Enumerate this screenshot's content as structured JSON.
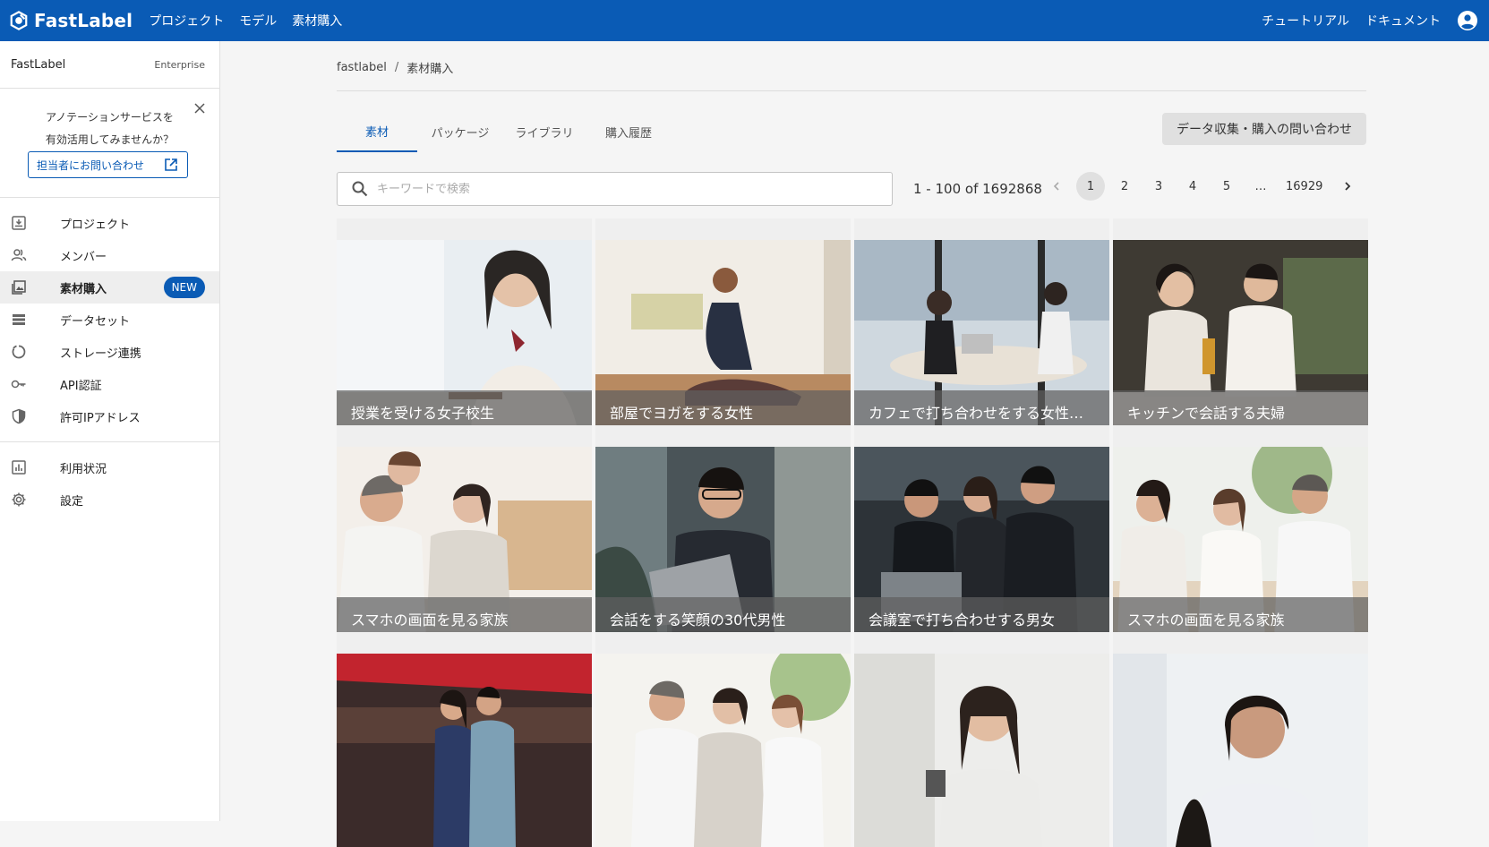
{
  "app": {
    "brand": "FastLabel"
  },
  "topnav": {
    "items": [
      "プロジェクト",
      "モデル",
      "素材購入"
    ],
    "right": [
      "チュートリアル",
      "ドキュメント"
    ]
  },
  "sidebar": {
    "org_name": "FastLabel",
    "org_plan": "Enterprise",
    "promo": {
      "line1": "アノテーションサービスを",
      "line2": "有効活用してみませんか？",
      "link_label": "担当者にお問い合わせ"
    },
    "items": [
      {
        "label": "プロジェクト",
        "icon": "project-icon"
      },
      {
        "label": "メンバー",
        "icon": "members-icon"
      },
      {
        "label": "素材購入",
        "icon": "image-icon",
        "badge": "NEW",
        "active": true
      },
      {
        "label": "データセット",
        "icon": "dataset-icon"
      },
      {
        "label": "ストレージ連携",
        "icon": "storage-icon"
      },
      {
        "label": "API認証",
        "icon": "key-icon"
      },
      {
        "label": "許可IPアドレス",
        "icon": "shield-icon"
      }
    ],
    "items2": [
      {
        "label": "利用状況",
        "icon": "chart-icon"
      },
      {
        "label": "設定",
        "icon": "gear-icon"
      }
    ]
  },
  "breadcrumb": {
    "root": "fastlabel",
    "sep": "/",
    "current": "素材購入"
  },
  "tabs": [
    "素材",
    "パッケージ",
    "ライブラリ",
    "購入履歴"
  ],
  "contact_button": "データ収集・購入の問い合わせ",
  "search": {
    "placeholder": "キーワードで検索",
    "value": ""
  },
  "pagination": {
    "range": "1 - 100 of 1692868",
    "pages": [
      "1",
      "2",
      "3",
      "4",
      "5",
      "…",
      "16929"
    ],
    "current": "1"
  },
  "assets": [
    {
      "caption": "授業を受ける女子校生"
    },
    {
      "caption": "部屋でヨガをする女性"
    },
    {
      "caption": "カフェで打ち合わせをする女性…"
    },
    {
      "caption": "キッチンで会話する夫婦"
    },
    {
      "caption": "スマホの画面を見る家族"
    },
    {
      "caption": "会話をする笑顔の30代男性"
    },
    {
      "caption": "会議室で打ち合わせする男女"
    },
    {
      "caption": "スマホの画面を見る家族"
    },
    {
      "caption": ""
    },
    {
      "caption": ""
    },
    {
      "caption": ""
    },
    {
      "caption": ""
    }
  ],
  "colors": {
    "brand": "#0a5bb5",
    "sidebar_active": "#eeeeee"
  }
}
